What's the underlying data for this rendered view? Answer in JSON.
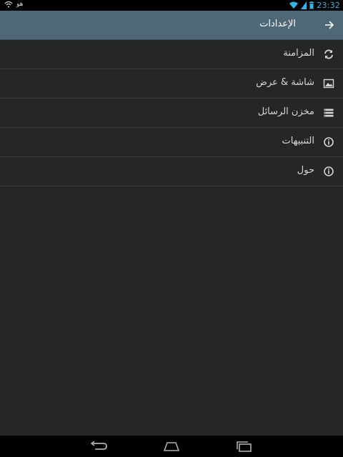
{
  "status_bar": {
    "carrier": "هو",
    "time": "23:32"
  },
  "action_bar": {
    "title": "الإعدادات"
  },
  "menu": {
    "items": [
      {
        "label": "المزامنة",
        "icon": "sync-icon"
      },
      {
        "label": "شاشة & عرض",
        "icon": "image-icon"
      },
      {
        "label": "مخزن الرسائل",
        "icon": "storage-list-icon"
      },
      {
        "label": "التنبيهات",
        "icon": "info-circle-icon"
      },
      {
        "label": "حول",
        "icon": "info-circle-icon"
      }
    ]
  },
  "nav_bar": {
    "buttons": [
      "back-icon",
      "home-icon",
      "recent-apps-icon"
    ]
  },
  "colors": {
    "action_bar": "#4e6877",
    "background": "#262626",
    "clock": "#33b5e5"
  }
}
